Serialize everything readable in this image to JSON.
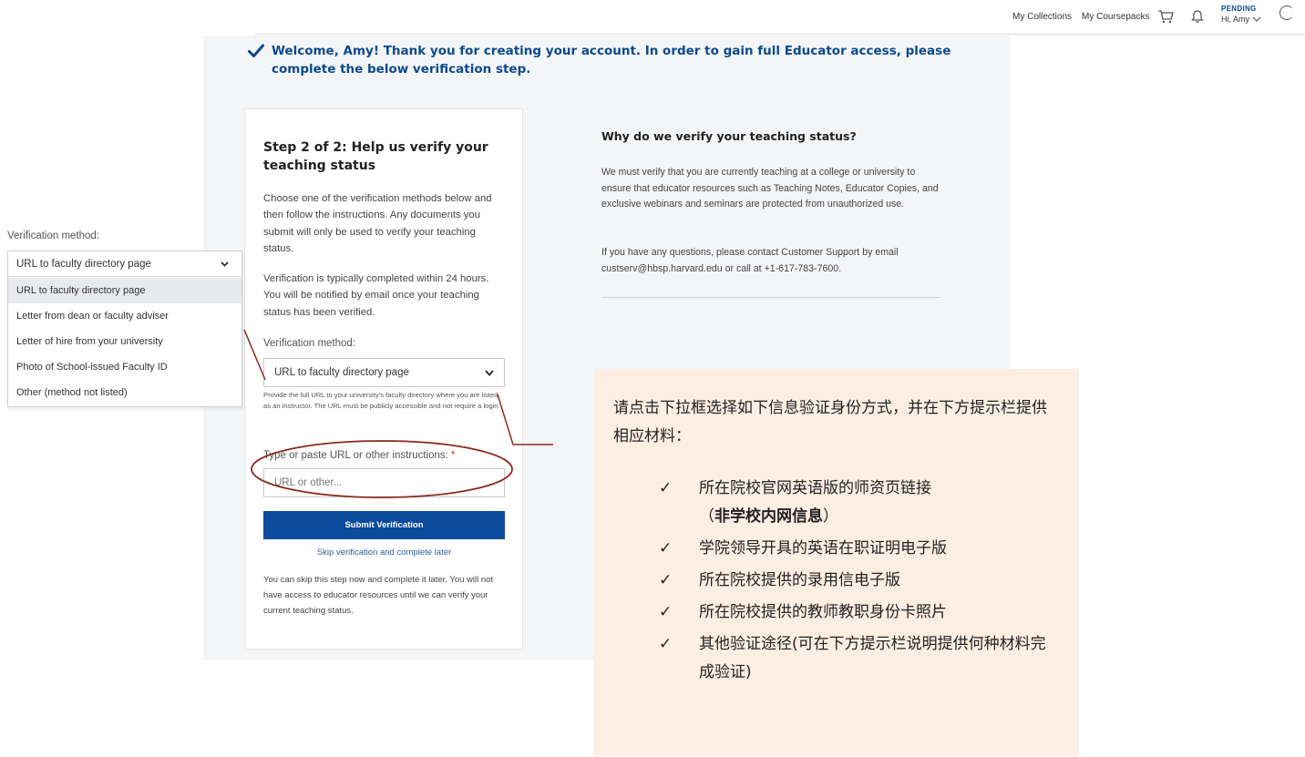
{
  "topnav": {
    "collections": "My Collections",
    "coursepacks": "My Coursepacks",
    "status": "PENDING",
    "user": "Hi, Amy"
  },
  "welcome": {
    "message": "Welcome, Amy! Thank you for creating your account. In order to gain full Educator access, please complete the below verification step."
  },
  "card": {
    "title": "Step 2 of 2: Help us verify your teaching status",
    "paragraph1": "Choose one of the verification methods below and then follow the instructions. Any documents you submit will only be used to verify your teaching status.",
    "paragraph2": "Verification is typically completed within 24 hours. You will be notified by email once your teaching status has been verified.",
    "method_label": "Verification method:",
    "method_selected": "URL to faculty directory page",
    "method_help": "Provide the full URL to your university's faculty directory where you are listed as an instructor. The URL must be publicly accessible and not require a login.",
    "url_label": "Type or paste URL or other instructions: ",
    "url_required": "*",
    "url_placeholder": "URL or other...",
    "submit_label": "Submit Verification",
    "skip_label": "Skip verification and complete later",
    "skip_note": "You can skip this step now and complete it later. You will not have access to educator resources until we can verify your current teaching status."
  },
  "info": {
    "title": "Why do we verify your teaching status?",
    "paragraph1": "We must verify that you are currently teaching at a college or university to ensure that educator resources such as Teaching Notes, Educator Copies, and exclusive webinars and seminars are protected from unauthorized use.",
    "paragraph2": "If you have any questions, please contact Customer Support by email custserv@hbsp.harvard.edu or call at +1-617-783-7600."
  },
  "dropdown": {
    "label": "Verification method:",
    "selected": "URL to faculty directory page",
    "options": [
      "URL to faculty directory page",
      "Letter from dean or faculty adviser",
      "Letter of hire from your university",
      "Photo of School-issued Faculty ID",
      "Other (method not listed)"
    ]
  },
  "instructions": {
    "intro": "请点击下拉框选择如下信息验证身份方式，并在下方提示栏提供相应材料：",
    "check": "✓",
    "item1_text": "所在院校官网英语版的师资页链接",
    "item1_paren_open": "（",
    "item1_bold": "非学校内网信息",
    "item1_paren_close": "）",
    "item2": "学院领导开具的英语在职证明电子版",
    "item3": "所在院校提供的录用信电子版",
    "item4": "所在院校提供的教师教职身份卡照片",
    "item5": "其他验证途径(可在下方提示栏说明提供何种材料完成验证)"
  },
  "colors": {
    "brand_blue": "#0c4a9b",
    "annotation_brown": "#8b2a1c",
    "note_background": "#fdeee4"
  }
}
